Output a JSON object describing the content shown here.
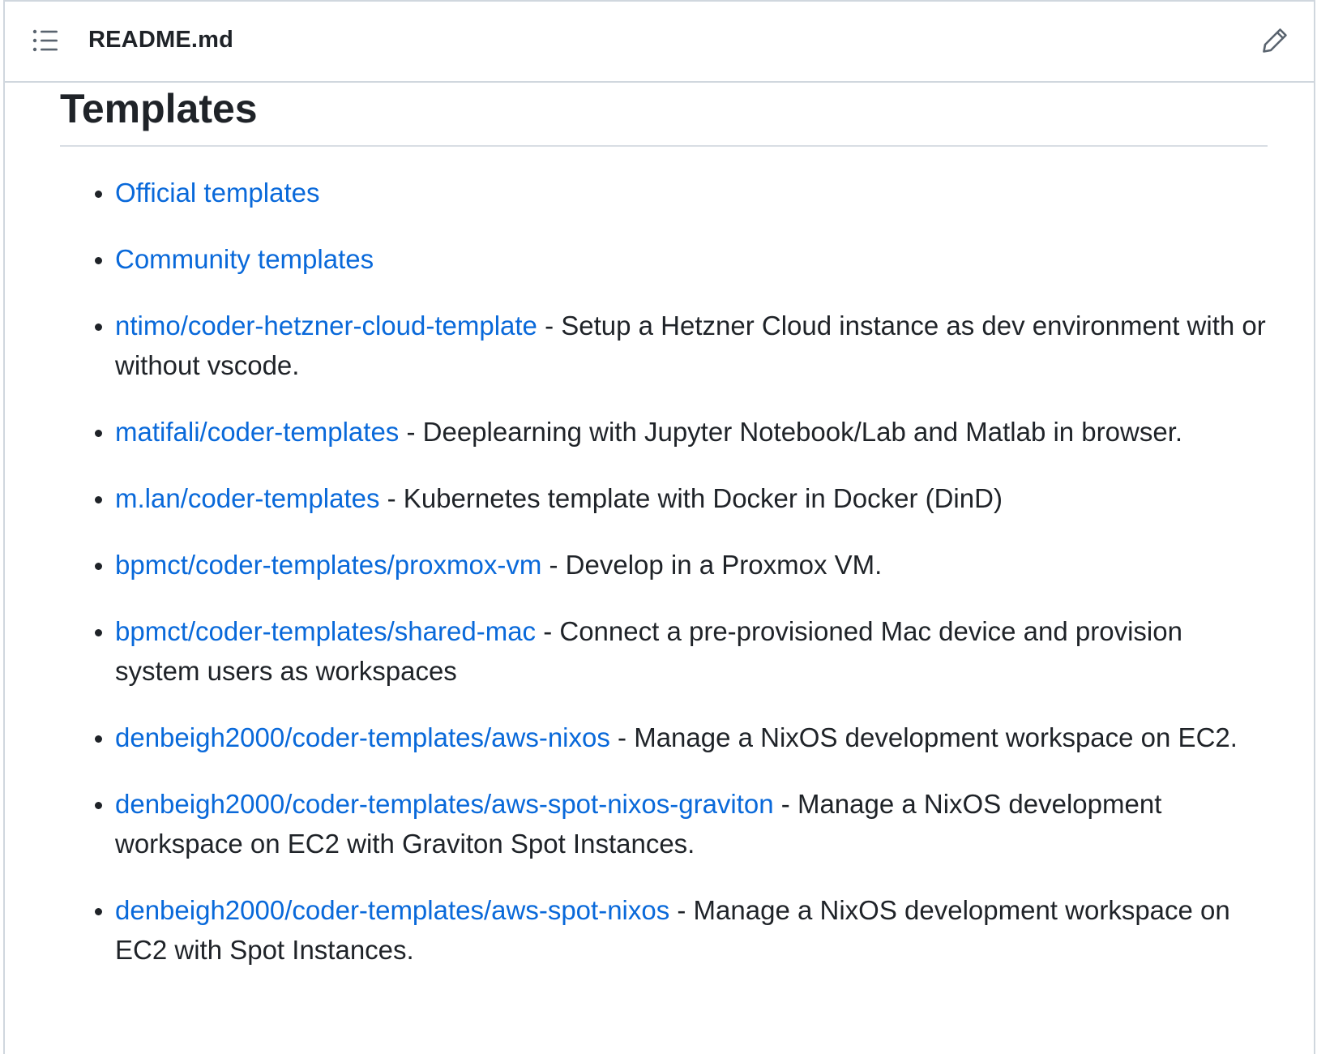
{
  "file_header": {
    "filename": "README.md",
    "outline_icon": "list-unordered-icon",
    "edit_icon": "pencil-icon"
  },
  "section": {
    "title": "Templates"
  },
  "templates": [
    {
      "link": "Official templates",
      "description": ""
    },
    {
      "link": "Community templates",
      "description": ""
    },
    {
      "link": "ntimo/coder-hetzner-cloud-template",
      "description": " - Setup a Hetzner Cloud instance as dev environment with or without vscode."
    },
    {
      "link": "matifali/coder-templates",
      "description": " - Deeplearning with Jupyter Notebook/Lab and Matlab in browser."
    },
    {
      "link": "m.lan/coder-templates",
      "description": " - Kubernetes template with Docker in Docker (DinD)"
    },
    {
      "link": "bpmct/coder-templates/proxmox-vm",
      "description": " - Develop in a Proxmox VM."
    },
    {
      "link": "bpmct/coder-templates/shared-mac",
      "description": " - Connect a pre-provisioned Mac device and provision system users as workspaces"
    },
    {
      "link": "denbeigh2000/coder-templates/aws-nixos",
      "description": " - Manage a NixOS development workspace on EC2."
    },
    {
      "link": "denbeigh2000/coder-templates/aws-spot-nixos-graviton",
      "description": " - Manage a NixOS development workspace on EC2 with Graviton Spot Instances."
    },
    {
      "link": "denbeigh2000/coder-templates/aws-spot-nixos",
      "description": " - Manage a NixOS development workspace on EC2 with Spot Instances."
    }
  ],
  "colors": {
    "link": "#0969da",
    "text": "#1f2328",
    "border": "#d0d7de"
  }
}
